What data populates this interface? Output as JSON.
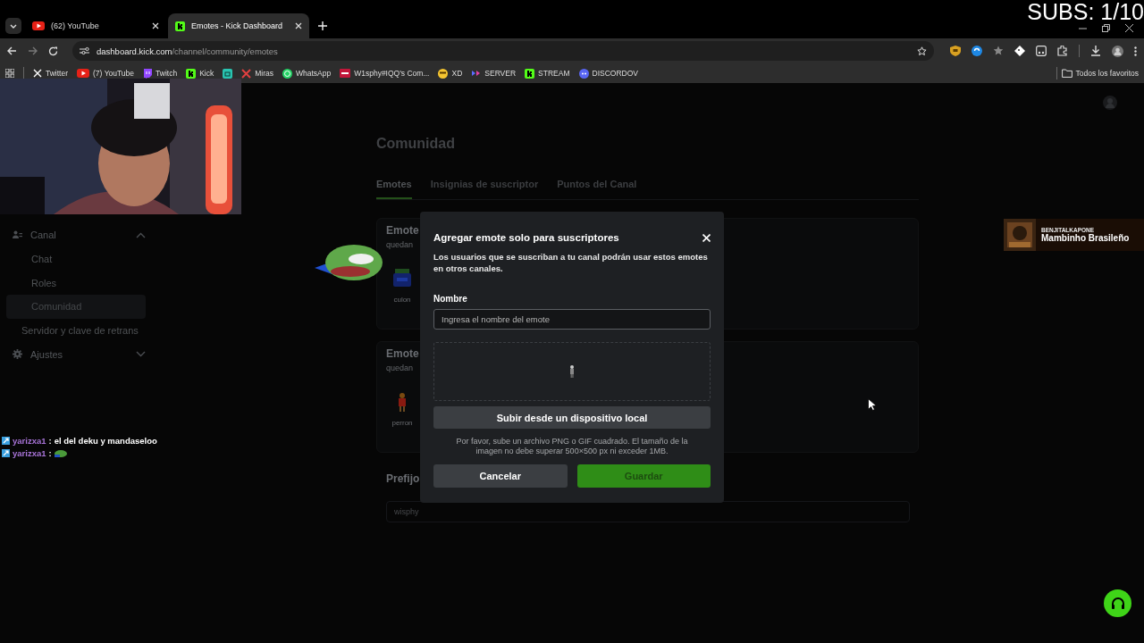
{
  "browser": {
    "tabs": [
      {
        "title": "(62) YouTube",
        "selected": false
      },
      {
        "title": "Emotes - Kick Dashboard",
        "selected": true
      }
    ],
    "address": {
      "host": "dashboard.kick.com",
      "path": "/channel/community/emotes"
    },
    "bookmarks": [
      {
        "label": "Twitter"
      },
      {
        "label": "(7) YouTube"
      },
      {
        "label": "Twitch"
      },
      {
        "label": "Kick"
      },
      {
        "kind": "icon"
      },
      {
        "label": "Miras"
      },
      {
        "label": "WhatsApp"
      },
      {
        "label": "W1sphy#IQQ's Com..."
      },
      {
        "label": "XD"
      },
      {
        "label": "SERVER"
      },
      {
        "label": "STREAM"
      },
      {
        "label": "DISCORDOV"
      }
    ],
    "all_bookmarks": "Todos los favoritos"
  },
  "sidebar": {
    "items": [
      {
        "kind": "group",
        "label": "Canal",
        "expanded": true,
        "children": [
          {
            "label": "Chat",
            "selected": false
          },
          {
            "label": "Roles",
            "selected": false
          },
          {
            "label": "Comunidad",
            "selected": true
          }
        ]
      },
      {
        "kind": "link",
        "label": "Servidor y clave de retrans"
      },
      {
        "kind": "group",
        "label": "Ajustes",
        "expanded": false
      }
    ]
  },
  "page": {
    "title": "Comunidad",
    "tabs": [
      {
        "label": "Emotes",
        "selected": true
      },
      {
        "label": "Insignias de suscriptor",
        "selected": false
      },
      {
        "label": "Puntos del Canal",
        "selected": false
      }
    ],
    "sections": [
      {
        "title": "Emote",
        "subtitle": "quedan",
        "emotes": [
          {
            "name": "culon"
          }
        ]
      },
      {
        "title": "Emote",
        "subtitle": "quedan",
        "emotes": [
          {
            "name": "perron"
          }
        ]
      }
    ],
    "prefix": {
      "label": "Prefijo",
      "value": "wisphy"
    }
  },
  "modal": {
    "title": "Agregar emote solo para suscriptores",
    "description": "Los usuarios que se suscriban a tu canal podrán usar estos emotes en otros canales.",
    "name_label": "Nombre",
    "name_placeholder": "Ingresa el nombre del emote",
    "upload_button": "Subir desde un dispositivo local",
    "hint": "Por favor, sube un archivo PNG o GIF cuadrado. El tamaño de la imagen no debe superar 500×500 px ni exceder 1MB.",
    "buttons": [
      {
        "label": "Cancelar",
        "kind": "secondary"
      },
      {
        "label": "Guardar",
        "kind": "primary"
      }
    ]
  },
  "stream_overlay": {
    "subs": "SUBS: 1/10",
    "chat": [
      {
        "user": "yarizxa1",
        "separator": ":",
        "kind": "text",
        "message": "el del deku y mandaseloo"
      },
      {
        "user": "yarizxa1",
        "separator": ":",
        "kind": "emote"
      }
    ],
    "now_playing": {
      "artist": "BENJITALKAPONE",
      "title": "Mambinho Brasileño"
    }
  }
}
